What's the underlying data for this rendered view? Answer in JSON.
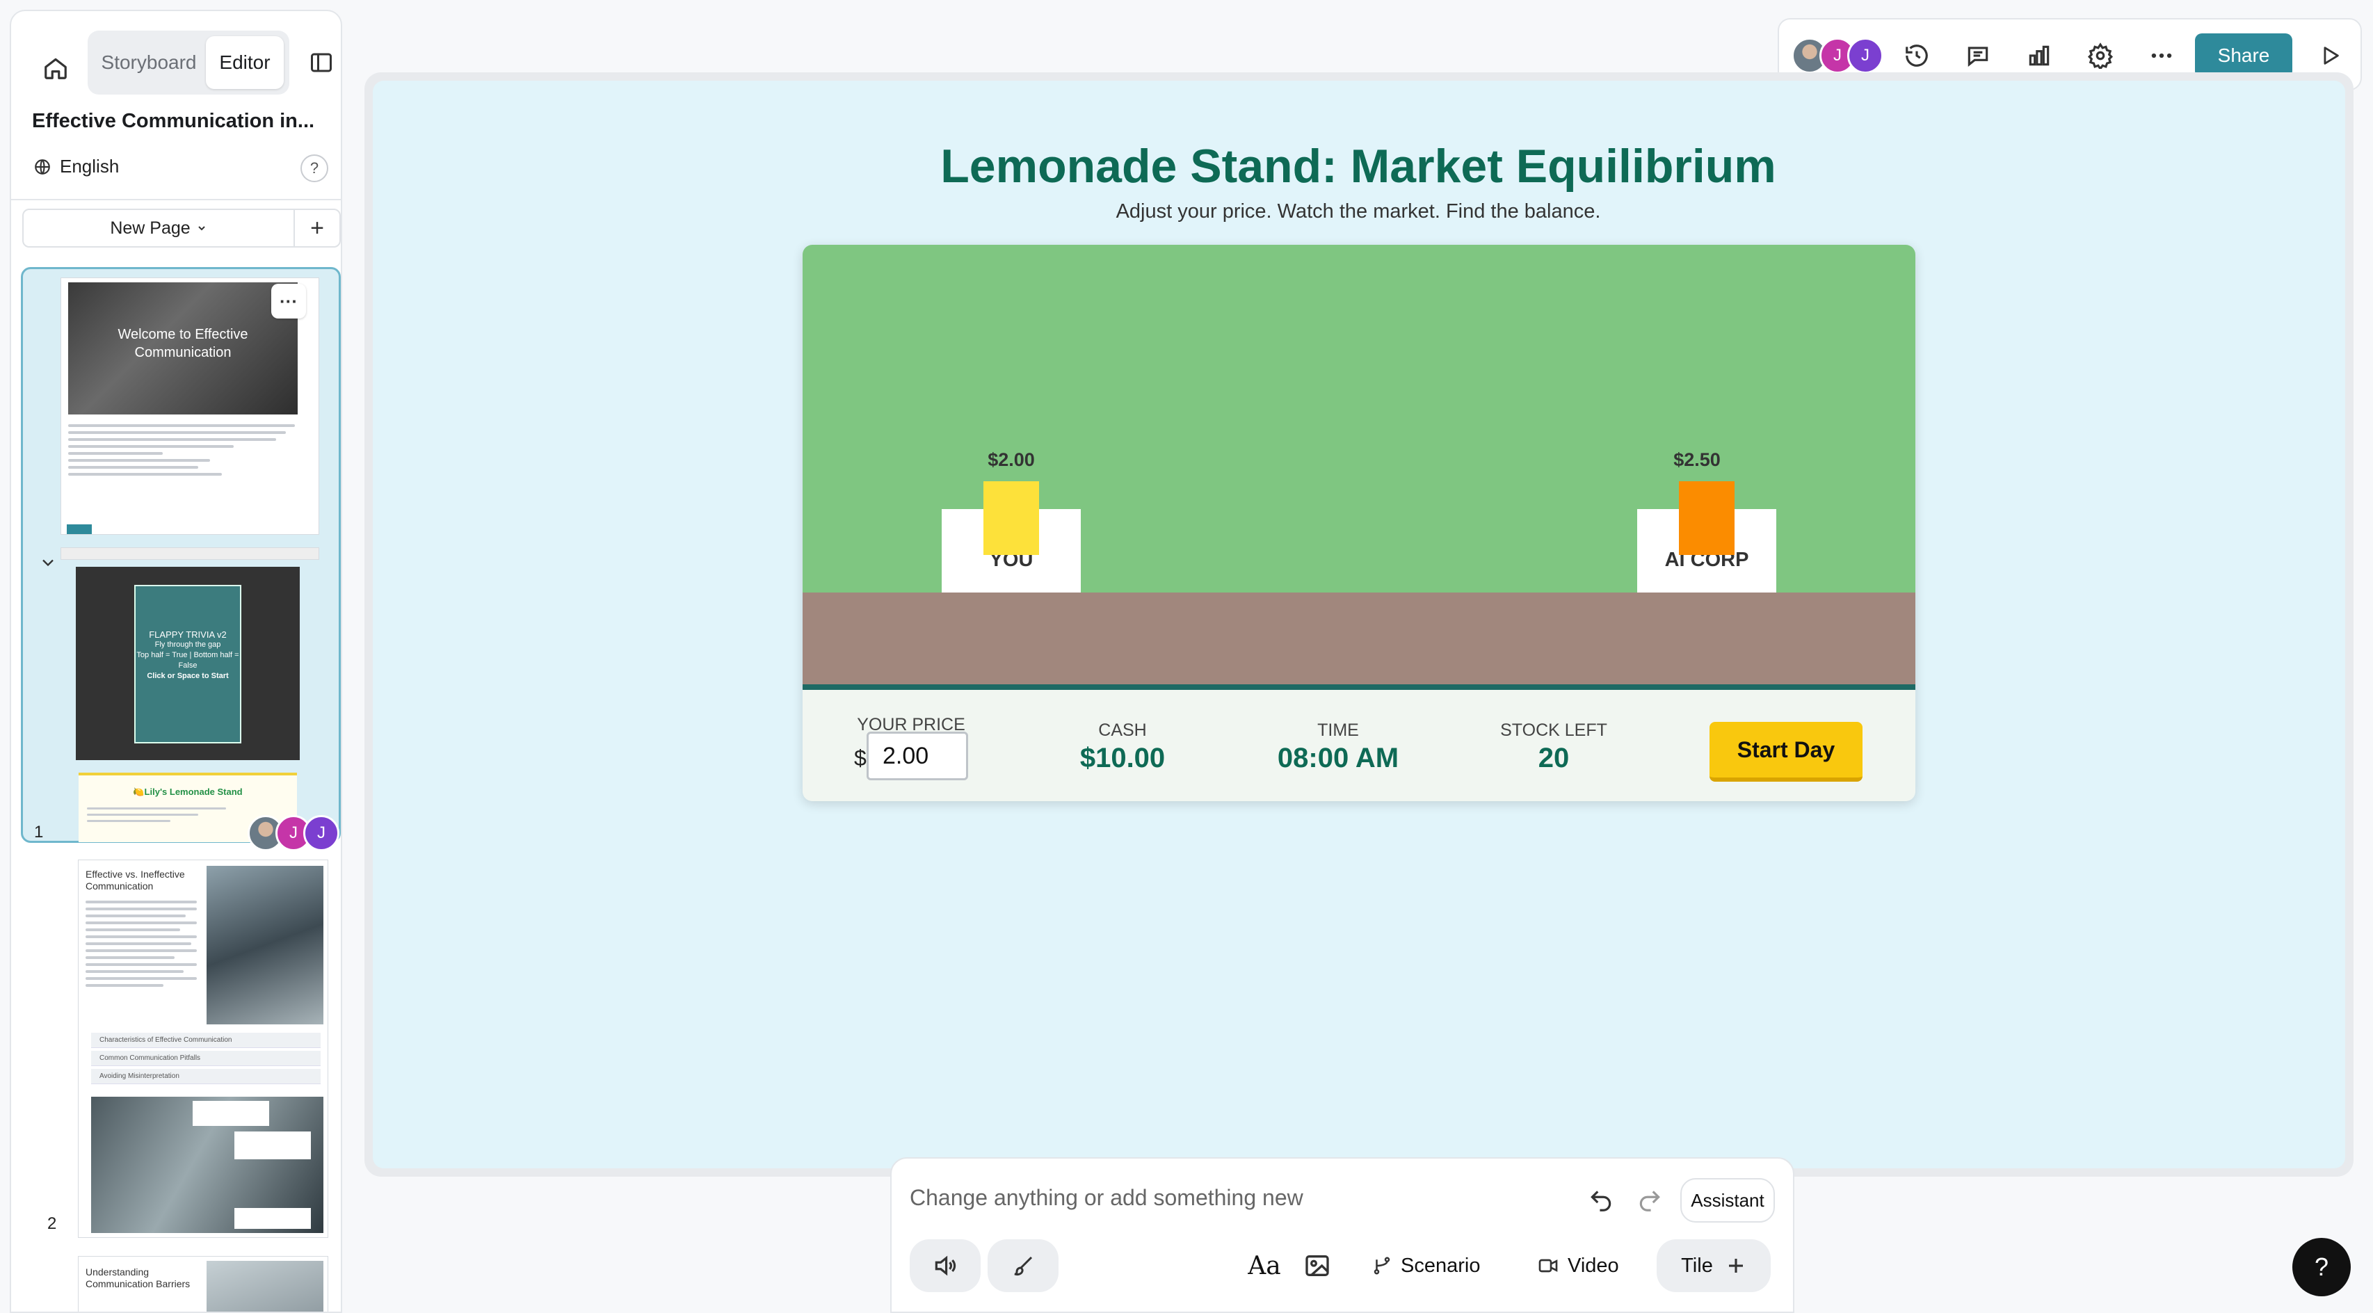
{
  "sidebar": {
    "mode_tabs": {
      "storyboard": "Storyboard",
      "editor": "Editor"
    },
    "course_title": "Effective Communication in...",
    "language": "English",
    "help": "?",
    "new_page_label": "New Page",
    "add_page": "+",
    "pages": [
      {
        "number": "1",
        "welcome_title": "Welcome to Effective Communication",
        "menu": "···",
        "flappy": {
          "title": "FLAPPY TRIVIA v2",
          "line1": "Fly through the gap",
          "line2": "Top half = True | Bottom half = False",
          "cta": "Click or Space to Start"
        },
        "lemonade_title": "🍋Lily's Lemonade Stand"
      },
      {
        "number": "2",
        "heading": "Effective vs. Ineffective Communication",
        "accordion": [
          "Characteristics of Effective Communication",
          "Common Communication Pitfalls",
          "Avoiding Misinterpretation"
        ]
      },
      {
        "heading": "Understanding Communication Barriers"
      }
    ],
    "collaborators": [
      "J",
      "J"
    ]
  },
  "toolbar": {
    "collaborators": [
      "J",
      "J"
    ],
    "icons": [
      "history-icon",
      "comment-icon",
      "analytics-icon",
      "settings-icon",
      "more-icon"
    ],
    "share_label": "Share"
  },
  "game": {
    "title": "Lemonade Stand: Market Equilibrium",
    "subtitle": "Adjust your price. Watch the market. Find the balance.",
    "you": {
      "label": "YOU",
      "price": "$2.00",
      "cup_color": "#fde13a"
    },
    "ai": {
      "label": "AI CORP",
      "price": "$2.50",
      "cup_color": "#fb8c00"
    },
    "hud": {
      "your_price_label": "YOUR PRICE",
      "currency": "$",
      "your_price_value": "2.00",
      "cash_label": "CASH",
      "cash_value": "$10.00",
      "time_label": "TIME",
      "time_value": "08:00 AM",
      "stock_label": "STOCK LEFT",
      "stock_value": "20",
      "start_label": "Start Day"
    },
    "colors": {
      "grass": "#7fc681",
      "dirt": "#a1877d",
      "title": "#0e6a55",
      "button": "#f9c80e"
    }
  },
  "composer": {
    "placeholder": "Change anything or add something new",
    "assistant_label": "Assistant",
    "tools": {
      "scenario": "Scenario",
      "video": "Video",
      "tile": "Tile"
    }
  },
  "help_fab": "?"
}
